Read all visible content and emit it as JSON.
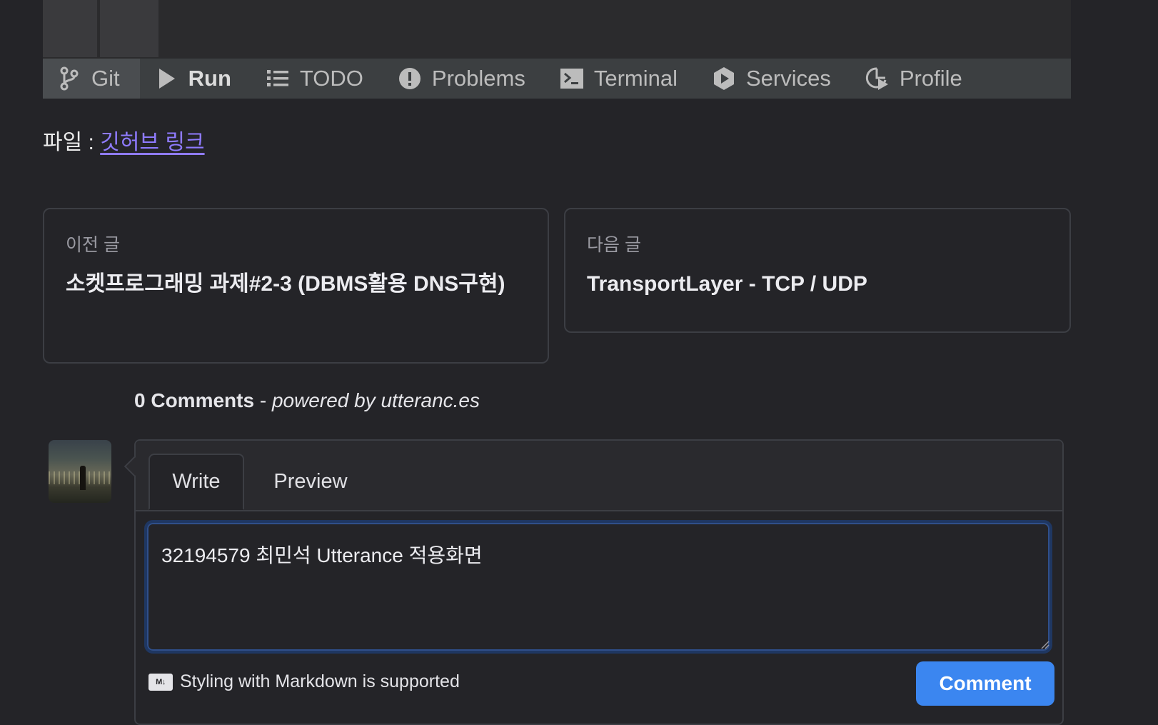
{
  "ide": {
    "tool_windows": [
      {
        "label": "Git",
        "icon": "git-branch-icon"
      },
      {
        "label": "Run",
        "icon": "play-icon"
      },
      {
        "label": "TODO",
        "icon": "list-icon"
      },
      {
        "label": "Problems",
        "icon": "exclamation-icon"
      },
      {
        "label": "Terminal",
        "icon": "terminal-icon"
      },
      {
        "label": "Services",
        "icon": "services-icon"
      },
      {
        "label": "Profile",
        "icon": "profiler-icon"
      }
    ]
  },
  "file": {
    "label": "파일 : ",
    "link_text": "깃허브 링크"
  },
  "nav": {
    "prev": {
      "label": "이전 글",
      "title": "소켓프로그래밍 과제#2-3 (DBMS활용 DNS구현)"
    },
    "next": {
      "label": "다음 글",
      "title": "TransportLayer - TCP / UDP"
    }
  },
  "comments": {
    "count": "0 Comments",
    "separator": " - ",
    "powered_by": "powered by utteranc.es",
    "tabs": {
      "write": "Write",
      "preview": "Preview"
    },
    "textarea_value": "32194579 최민석 Utterance 적용화면",
    "markdown_badge": "M↓",
    "markdown_note": "Styling with Markdown is supported",
    "submit_label": "Comment"
  },
  "colors": {
    "background": "#242428",
    "link": "#8f7bff",
    "primary_button": "#3b86f0",
    "ide_toolbar": "#3c3f41"
  }
}
